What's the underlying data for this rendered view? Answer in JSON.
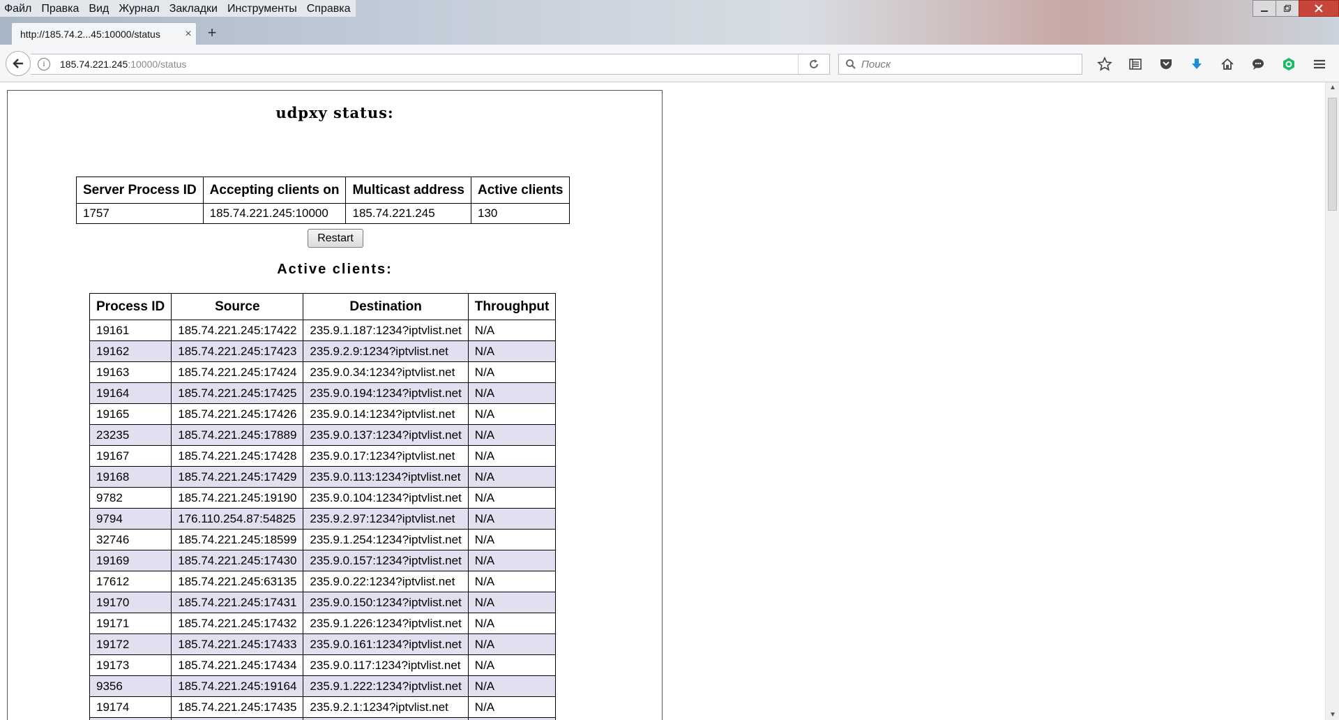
{
  "menubar": [
    "Файл",
    "Правка",
    "Вид",
    "Журнал",
    "Закладки",
    "Инструменты",
    "Справка"
  ],
  "tab": {
    "title": "http://185.74.2...45:10000/status",
    "close": "×",
    "new_tab": "+"
  },
  "url": {
    "host": "185.74.221.245",
    "path": ":10000/status"
  },
  "search": {
    "placeholder": "Поиск"
  },
  "page": {
    "title": "udpxy status:",
    "server_headers": [
      "Server Process ID",
      "Accepting clients on",
      "Multicast address",
      "Active clients"
    ],
    "server_row": [
      "1757",
      "185.74.221.245:10000",
      "185.74.221.245",
      "130"
    ],
    "restart_label": "Restart",
    "clients_title": "Active clients:",
    "client_headers": [
      "Process ID",
      "Source",
      "Destination",
      "Throughput"
    ],
    "clients": [
      [
        "19161",
        "185.74.221.245:17422",
        "235.9.1.187:1234?iptvlist.net",
        "N/A"
      ],
      [
        "19162",
        "185.74.221.245:17423",
        "235.9.2.9:1234?iptvlist.net",
        "N/A"
      ],
      [
        "19163",
        "185.74.221.245:17424",
        "235.9.0.34:1234?iptvlist.net",
        "N/A"
      ],
      [
        "19164",
        "185.74.221.245:17425",
        "235.9.0.194:1234?iptvlist.net",
        "N/A"
      ],
      [
        "19165",
        "185.74.221.245:17426",
        "235.9.0.14:1234?iptvlist.net",
        "N/A"
      ],
      [
        "23235",
        "185.74.221.245:17889",
        "235.9.0.137:1234?iptvlist.net",
        "N/A"
      ],
      [
        "19167",
        "185.74.221.245:17428",
        "235.9.0.17:1234?iptvlist.net",
        "N/A"
      ],
      [
        "19168",
        "185.74.221.245:17429",
        "235.9.0.113:1234?iptvlist.net",
        "N/A"
      ],
      [
        "9782",
        "185.74.221.245:19190",
        "235.9.0.104:1234?iptvlist.net",
        "N/A"
      ],
      [
        "9794",
        "176.110.254.87:54825",
        "235.9.2.97:1234?iptvlist.net",
        "N/A"
      ],
      [
        "32746",
        "185.74.221.245:18599",
        "235.9.1.254:1234?iptvlist.net",
        "N/A"
      ],
      [
        "19169",
        "185.74.221.245:17430",
        "235.9.0.157:1234?iptvlist.net",
        "N/A"
      ],
      [
        "17612",
        "185.74.221.245:63135",
        "235.9.0.22:1234?iptvlist.net",
        "N/A"
      ],
      [
        "19170",
        "185.74.221.245:17431",
        "235.9.0.150:1234?iptvlist.net",
        "N/A"
      ],
      [
        "19171",
        "185.74.221.245:17432",
        "235.9.1.226:1234?iptvlist.net",
        "N/A"
      ],
      [
        "19172",
        "185.74.221.245:17433",
        "235.9.0.161:1234?iptvlist.net",
        "N/A"
      ],
      [
        "19173",
        "185.74.221.245:17434",
        "235.9.0.117:1234?iptvlist.net",
        "N/A"
      ],
      [
        "9356",
        "185.74.221.245:19164",
        "235.9.1.222:1234?iptvlist.net",
        "N/A"
      ],
      [
        "19174",
        "185.74.221.245:17435",
        "235.9.2.1:1234?iptvlist.net",
        "N/A"
      ],
      [
        "",
        "",
        "",
        ""
      ]
    ]
  },
  "icons": {
    "nav": [
      "back-arrow-icon",
      "info-icon",
      "reload-icon",
      "search-icon"
    ],
    "toolbar": [
      "bookmark-star-icon",
      "reading-list-icon",
      "pocket-icon",
      "downloads-icon",
      "home-icon",
      "chat-icon",
      "extension-icon",
      "hamburger-menu-icon"
    ]
  },
  "colors": {
    "row_alt": "#e0e0f0",
    "download_arrow": "#1a8fd6",
    "extension_green": "#1fb86a",
    "close_button": "#c7453a"
  }
}
